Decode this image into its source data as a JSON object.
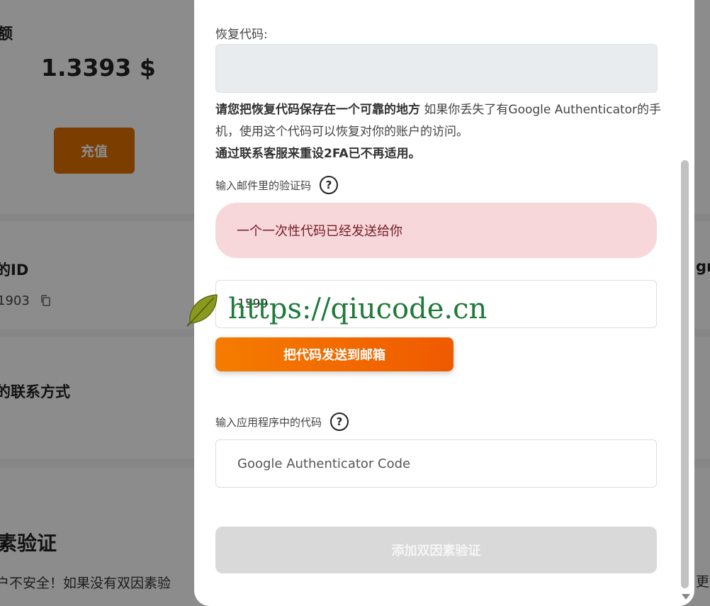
{
  "background": {
    "balance_label": "额",
    "balance_value": "1.3393 $",
    "recharge_button": "充值",
    "id_label": "的ID",
    "id_value": "1903",
    "contact_label": "的联系方式",
    "twofa_title": "素验证",
    "twofa_desc": "户不安全！如果没有双因素验",
    "right_edge_text": "gr",
    "right_edge_text2": "更"
  },
  "modal": {
    "recovery_label": "恢复代码:",
    "recovery_note_bold": "请您把恢复代码保存在一个可靠的地方",
    "recovery_note_text": " 如果你丢失了有Google Authenticator的手机，使用这个代码可以恢复对你的账户的访问。",
    "recovery_note_bold2": "通过联系客服来重设2FA已不再适用。",
    "email_code_label": "输入邮件里的验证码",
    "alert_text": "一个一次性代码已经发送给你",
    "email_code_value": "1599",
    "send_button": "把代码发送到邮箱",
    "app_code_label": "输入应用程序中的代码",
    "app_code_placeholder": "Google Authenticator Code",
    "add_button": "添加双因素验证",
    "help_glyph": "?"
  },
  "watermark": {
    "text": "https://qiucode.cn"
  },
  "colors": {
    "accent_orange": "#f57c00",
    "alert_bg": "#f8d7da",
    "alert_text": "#721c24",
    "disabled_button": "#d9d9d9"
  }
}
